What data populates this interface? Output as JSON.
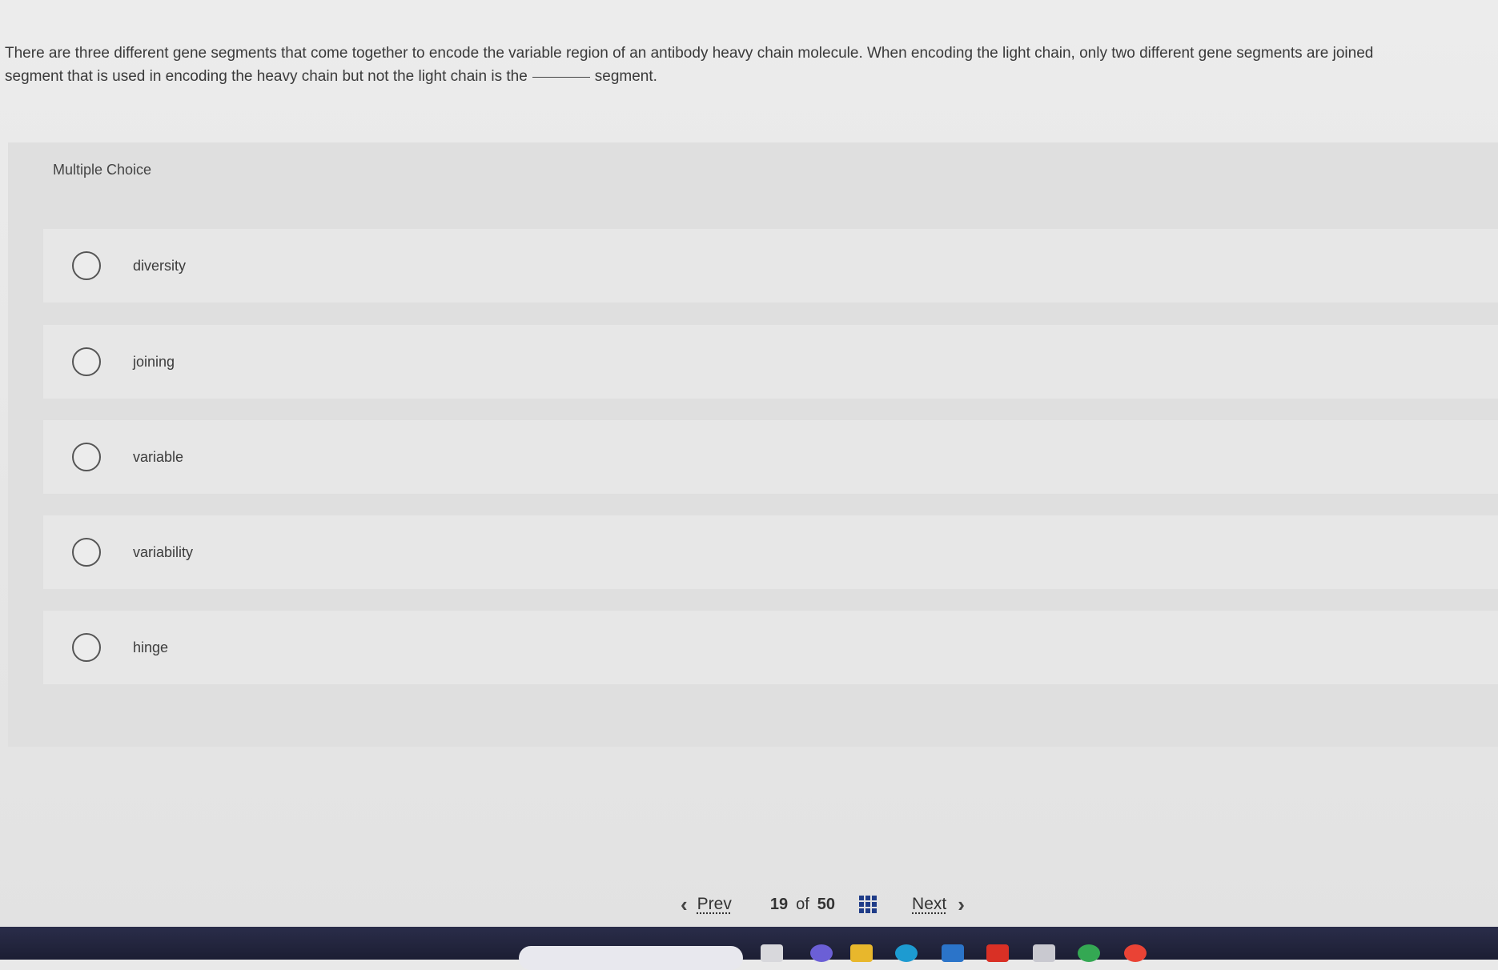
{
  "question": {
    "line1": "There are three different gene segments that come together to encode the variable region of an antibody heavy chain molecule. When encoding the light chain, only two different gene segments are joined",
    "line2_before": "segment that is used in encoding the heavy chain but not the light chain is the",
    "line2_after": "segment."
  },
  "multiple_choice": {
    "label": "Multiple Choice",
    "options": [
      {
        "label": "diversity"
      },
      {
        "label": "joining"
      },
      {
        "label": "variable"
      },
      {
        "label": "variability"
      },
      {
        "label": "hinge"
      }
    ]
  },
  "navigation": {
    "prev_label": "Prev",
    "current": "19",
    "of_label": "of",
    "total": "50",
    "next_label": "Next"
  },
  "icons": {
    "prev": "chevron-left-icon",
    "next": "chevron-right-icon",
    "grid": "grid-icon",
    "radio": "radio-unchecked-icon"
  },
  "colors": {
    "grid_icon": "#1f3c88",
    "taskbar": "#1c1e33"
  }
}
